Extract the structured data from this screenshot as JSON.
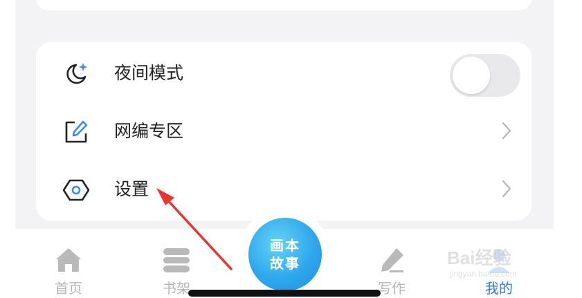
{
  "settings": {
    "items": [
      {
        "label": "夜间模式",
        "icon": "moon-star-icon",
        "control": "toggle",
        "toggle_on": false
      },
      {
        "label": "网编专区",
        "icon": "edit-square-icon",
        "control": "chevron"
      },
      {
        "label": "设置",
        "icon": "hexagon-settings-icon",
        "control": "chevron"
      }
    ]
  },
  "tabbar": {
    "tabs": [
      {
        "label": "首页",
        "icon": "home-icon",
        "active": false
      },
      {
        "label": "书架",
        "icon": "bookshelf-icon",
        "active": false
      },
      {
        "label": "写作",
        "icon": "pen-icon",
        "active": false
      },
      {
        "label": "我的",
        "icon": "profile-icon",
        "active": true
      }
    ],
    "center_line1": "画本",
    "center_line2": "故事"
  },
  "watermark": {
    "brand": "Bai经验",
    "url": "jingyan.baidu.com"
  },
  "colors": {
    "accent": "#2b7be8",
    "center_button": "#2fa7ec",
    "arrow": "#e8352e",
    "panel_bg": "#f3f3f5"
  }
}
